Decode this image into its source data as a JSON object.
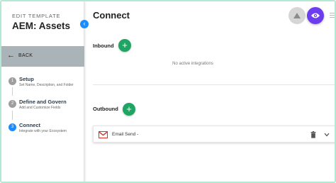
{
  "sidebar": {
    "eyebrow": "EDIT TEMPLATE",
    "title": "AEM: Assets",
    "back_label": "BACK",
    "steps": [
      {
        "number": "1",
        "title": "Setup",
        "description": "Set Name, Description, and Folder",
        "state": "completed"
      },
      {
        "number": "2",
        "title": "Define and Govern",
        "description": "Add and Customize Fields",
        "state": "completed"
      },
      {
        "number": "3",
        "title": "Connect",
        "description": "Integrate with your Ecosystem",
        "state": "active"
      }
    ]
  },
  "main": {
    "title": "Connect",
    "inbound": {
      "label": "Inbound",
      "empty_message": "No active integrations"
    },
    "outbound": {
      "label": "Outbound",
      "items": [
        {
          "label": "Email Send -",
          "icon": "gmail-icon"
        }
      ]
    }
  },
  "colors": {
    "accent_blue": "#1a8cff",
    "add_green": "#1fa463",
    "preview_purple": "#6c3cf0",
    "back_bar": "#aab3b7",
    "border_mint": "#b5e8d3"
  }
}
